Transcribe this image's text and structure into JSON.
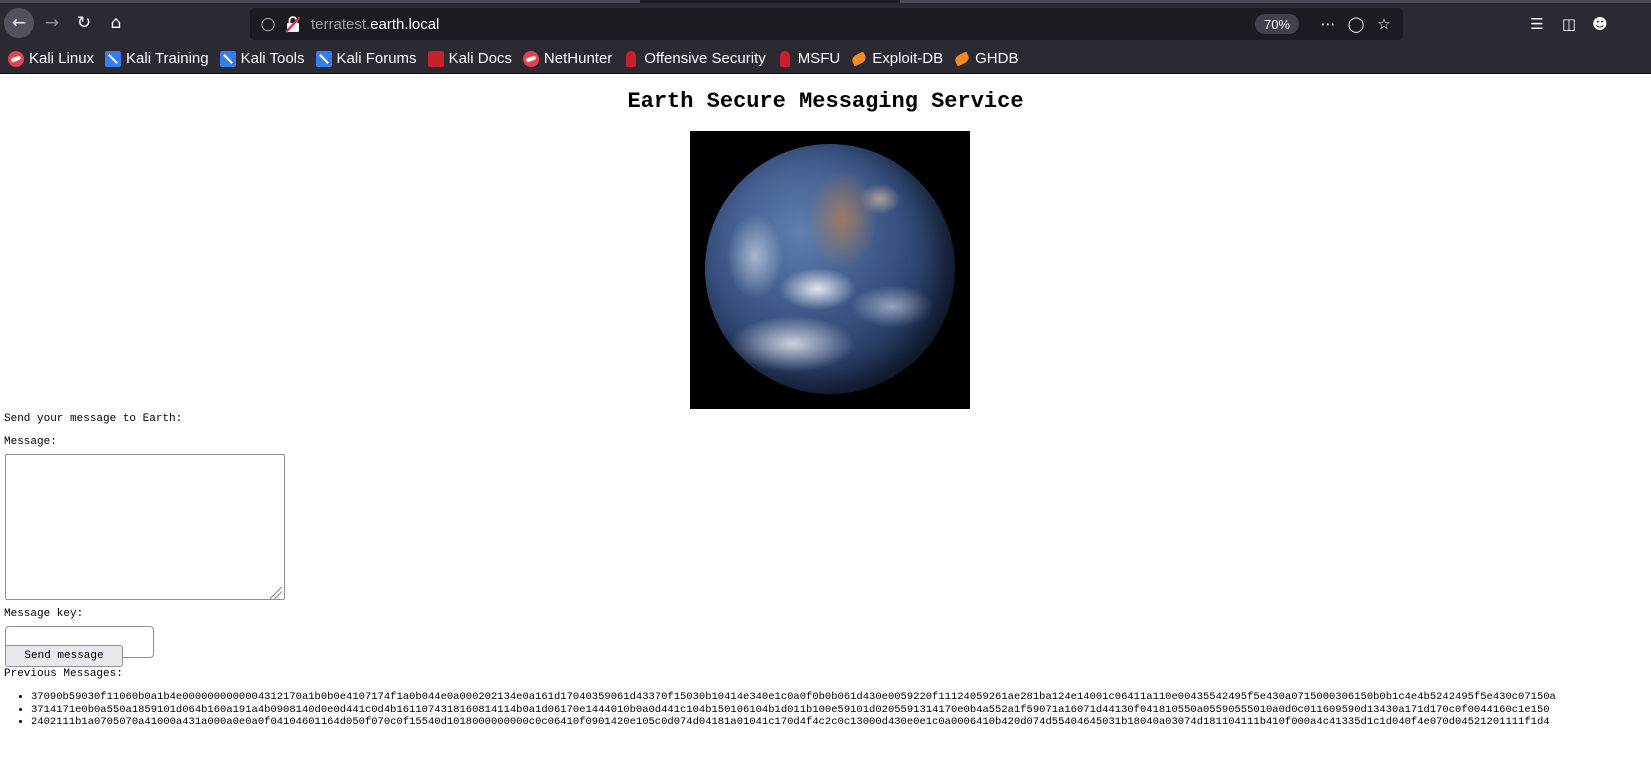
{
  "browser": {
    "url_subdomain": "terratest.",
    "url_domain": "earth.local",
    "zoom": "70%",
    "icons": {
      "back": "back-arrow-icon",
      "forward": "forward-arrow-icon",
      "reload": "reload-icon",
      "home": "home-icon",
      "shield": "tracking-shield-icon",
      "insecure": "insecure-lock-icon",
      "more": "more-horizontal-icon",
      "pocket": "pocket-icon",
      "bookmark": "star-icon",
      "library": "library-icon",
      "sidebar": "sidebar-icon",
      "account": "account-icon"
    },
    "colors": {
      "toolbar": "#2b2a33",
      "urlbar": "#1c1b22",
      "text": "#fbfbfe"
    }
  },
  "bookmarks": [
    {
      "label": "Kali Linux",
      "icon": "kali-dragon-icon"
    },
    {
      "label": "Kali Training",
      "icon": "kali-training-icon"
    },
    {
      "label": "Kali Tools",
      "icon": "kali-training-icon"
    },
    {
      "label": "Kali Forums",
      "icon": "kali-training-icon"
    },
    {
      "label": "Kali Docs",
      "icon": "kali-docs-icon"
    },
    {
      "label": "NetHunter",
      "icon": "kali-dragon-icon"
    },
    {
      "label": "Offensive Security",
      "icon": "offsec-icon"
    },
    {
      "label": "MSFU",
      "icon": "offsec-icon"
    },
    {
      "label": "Exploit-DB",
      "icon": "exploit-db-icon"
    },
    {
      "label": "GHDB",
      "icon": "exploit-db-icon"
    }
  ],
  "page": {
    "title": "Earth Secure Messaging Service",
    "image": "earth-globe-image",
    "send_label": "Send your message to Earth:",
    "message_label": "Message:",
    "message_value": "",
    "key_label": "Message key:",
    "key_value": "",
    "send_button": "Send message",
    "previous_label": "Previous Messages:",
    "messages": [
      "37090b59030f11060b0a1b4e0000000000004312170a1b0b0e4107174f1a0b044e0a000202134e0a161d17040359061d43370f15030b10414e340e1c0a0f0b0b061d430e0059220f11124059261ae281ba124e14001c06411a110e00435542495f5e430a0715000306150b0b1c4e4b5242495f5e430c07150a",
      "3714171e0b0a550a1859101d064b160a191a4b0908140d0e0d441c0d4b1611074318160814114b0a1d06170e1444010b0a0d441c104b150106104b1d011b100e59101d0205591314170e0b4a552a1f59071a16071d44130f041810550a05590555010a0d0c011609590d13430a171d170c0f0044160c1e150",
      "2402111b1a0705070a41000a431a000a0e0a0f04104601164d050f070c0f15540d1018000000000c0c06410f0901420e105c0d074d04181a01041c170d4f4c2c0c13000d430e0e1c0a0006410b420d074d55404645031b18040a03074d181104111b410f000a4c41335d1c1d040f4e070d04521201111f1d4"
    ]
  }
}
